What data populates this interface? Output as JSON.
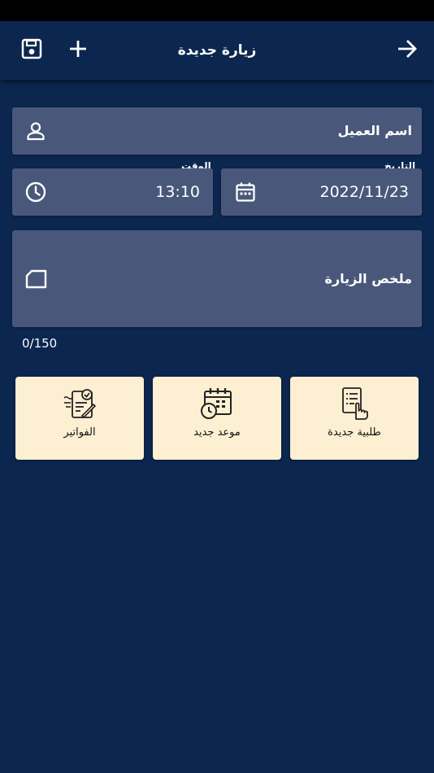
{
  "app_bar": {
    "title": "زيارة جديدة",
    "save_icon": "save-icon",
    "add_icon": "plus-icon",
    "forward_icon": "arrow-forward-icon"
  },
  "form": {
    "customer_name": {
      "placeholder": "اسم العميل",
      "icon": "person-icon"
    },
    "date": {
      "label": "التاريخ",
      "value": "2022/11/23",
      "icon": "calendar-icon"
    },
    "time": {
      "label": "الوقت",
      "value": "13:10",
      "icon": "clock-icon"
    },
    "summary": {
      "placeholder": "ملخص الزيارة",
      "icon": "label-icon",
      "counter": "0/150"
    }
  },
  "actions": [
    {
      "label": "طلبية جديدة",
      "icon": "checklist-hand-icon"
    },
    {
      "label": "موعد جديد",
      "icon": "calendar-clock-icon"
    },
    {
      "label": "الفواتير",
      "icon": "invoice-icon"
    }
  ],
  "colors": {
    "background": "#0b264f",
    "field": "#49587a",
    "card": "#fdefd2"
  }
}
